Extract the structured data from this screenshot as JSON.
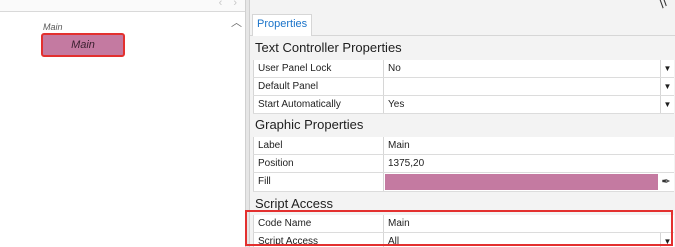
{
  "canvas": {
    "panel_title": "Main",
    "panel_widget_label": "Main",
    "panel_fill_color": "#c47aa1",
    "nav_arrows": "‹ ›"
  },
  "properties": {
    "tab_label": "Properties",
    "sections": [
      {
        "title": "Text Controller Properties",
        "rows": [
          {
            "key": "User Panel Lock",
            "value": "No",
            "dropdown": true
          },
          {
            "key": "Default Panel",
            "value": "",
            "dropdown": true
          },
          {
            "key": "Start Automatically",
            "value": "Yes",
            "dropdown": true
          }
        ]
      },
      {
        "title": "Graphic Properties",
        "rows": [
          {
            "key": "Label",
            "value": "Main"
          },
          {
            "key": "Position",
            "value": "1375,20"
          },
          {
            "key": "Fill",
            "value": "",
            "color": "#c47aa1"
          }
        ]
      },
      {
        "title": "Script Access",
        "rows": [
          {
            "key": "Code Name",
            "value": "Main"
          },
          {
            "key": "Script Access",
            "value": "All",
            "dropdown": true
          }
        ]
      }
    ]
  },
  "colors": {
    "accent_tab": "#1a73c9",
    "highlight": "#e3302f"
  }
}
